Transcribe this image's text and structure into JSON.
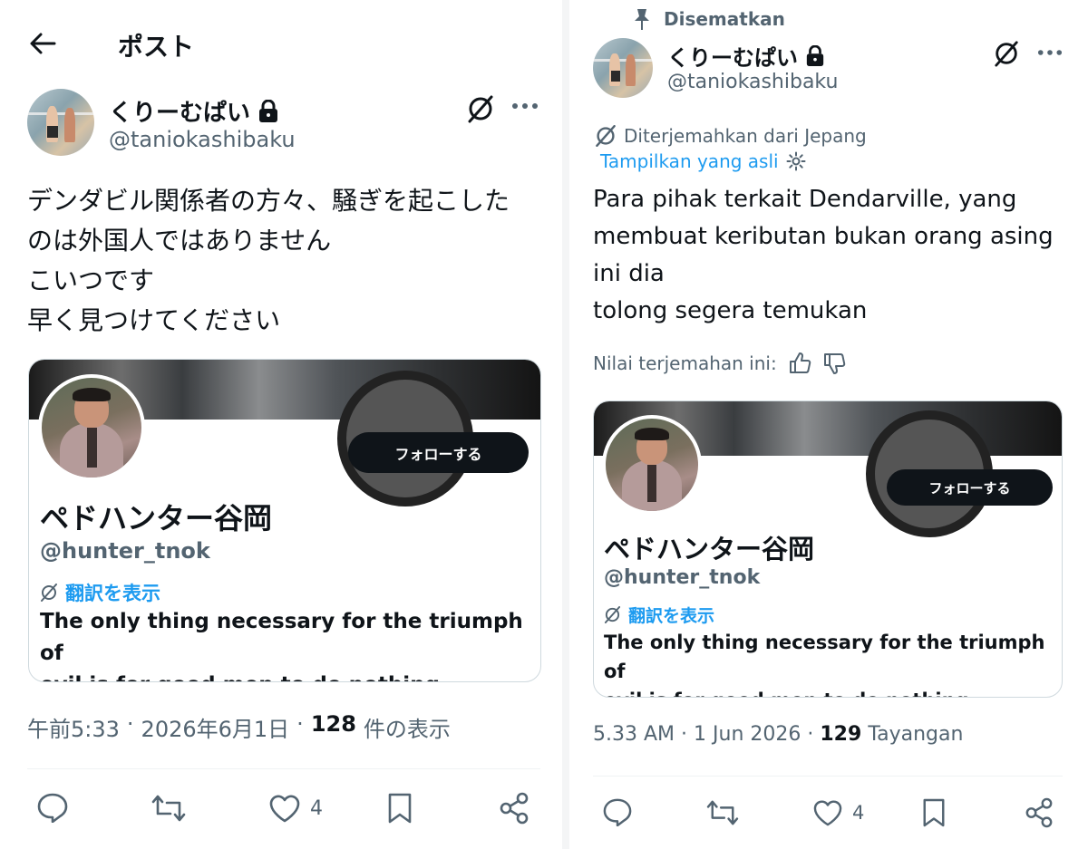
{
  "left": {
    "header_title": "ポスト",
    "author": {
      "name": "くりーむぱい",
      "handle": "@taniokashibaku"
    },
    "body_lines": [
      "デンダビル関係者の方々、騒ぎを起こした",
      "のは外国人ではありません",
      "こいつです",
      "早く見つけてください"
    ],
    "card": {
      "follow_label": "フォローする",
      "name": "ペドハンター谷岡",
      "handle": "@hunter_tnok",
      "translate_label": "翻訳を表示",
      "bio_lines": [
        "The only thing necessary for the triumph of",
        "evil is for good men to do nothing."
      ]
    },
    "meta": {
      "time": "午前5:33",
      "sep": "·",
      "date": "2026年6月1日",
      "views_count": "128",
      "views_label": "件の表示"
    },
    "actions": {
      "like_count": "4"
    }
  },
  "right": {
    "pinned_label": "Disematkan",
    "author": {
      "name": "くりーむぱい",
      "handle": "@taniokashibaku"
    },
    "translated_from": "Diterjemahkan dari Jepang",
    "show_original": "Tampilkan yang asli",
    "body_lines": [
      "Para pihak terkait Dendarville, yang",
      "membuat keributan bukan orang asing",
      "ini dia",
      "tolong segera temukan"
    ],
    "rate_label": "Nilai terjemahan ini:",
    "card": {
      "follow_label": "フォローする",
      "name": "ペドハンター谷岡",
      "handle": "@hunter_tnok",
      "translate_label": "翻訳を表示",
      "bio_lines": [
        "The only thing necessary for the triumph of",
        "evil is for good men to do nothing."
      ]
    },
    "meta": {
      "time": "5.33 AM",
      "sep": "·",
      "date": "1 Jun 2026",
      "views_count": "129",
      "views_label": "Tayangan"
    },
    "actions": {
      "like_count": "4"
    }
  },
  "icons": [
    "back-arrow-icon",
    "lock-icon",
    "grok-icon",
    "more-icon",
    "pin-icon",
    "settings-icon",
    "thumbs-up-icon",
    "thumbs-down-icon",
    "reply-icon",
    "retweet-icon",
    "like-icon",
    "bookmark-icon",
    "share-icon"
  ],
  "colors": {
    "text": "#0f1419",
    "secondary": "#536471",
    "link": "#1d9bf0",
    "border": "#cfd9de",
    "button": "#0f1419"
  }
}
